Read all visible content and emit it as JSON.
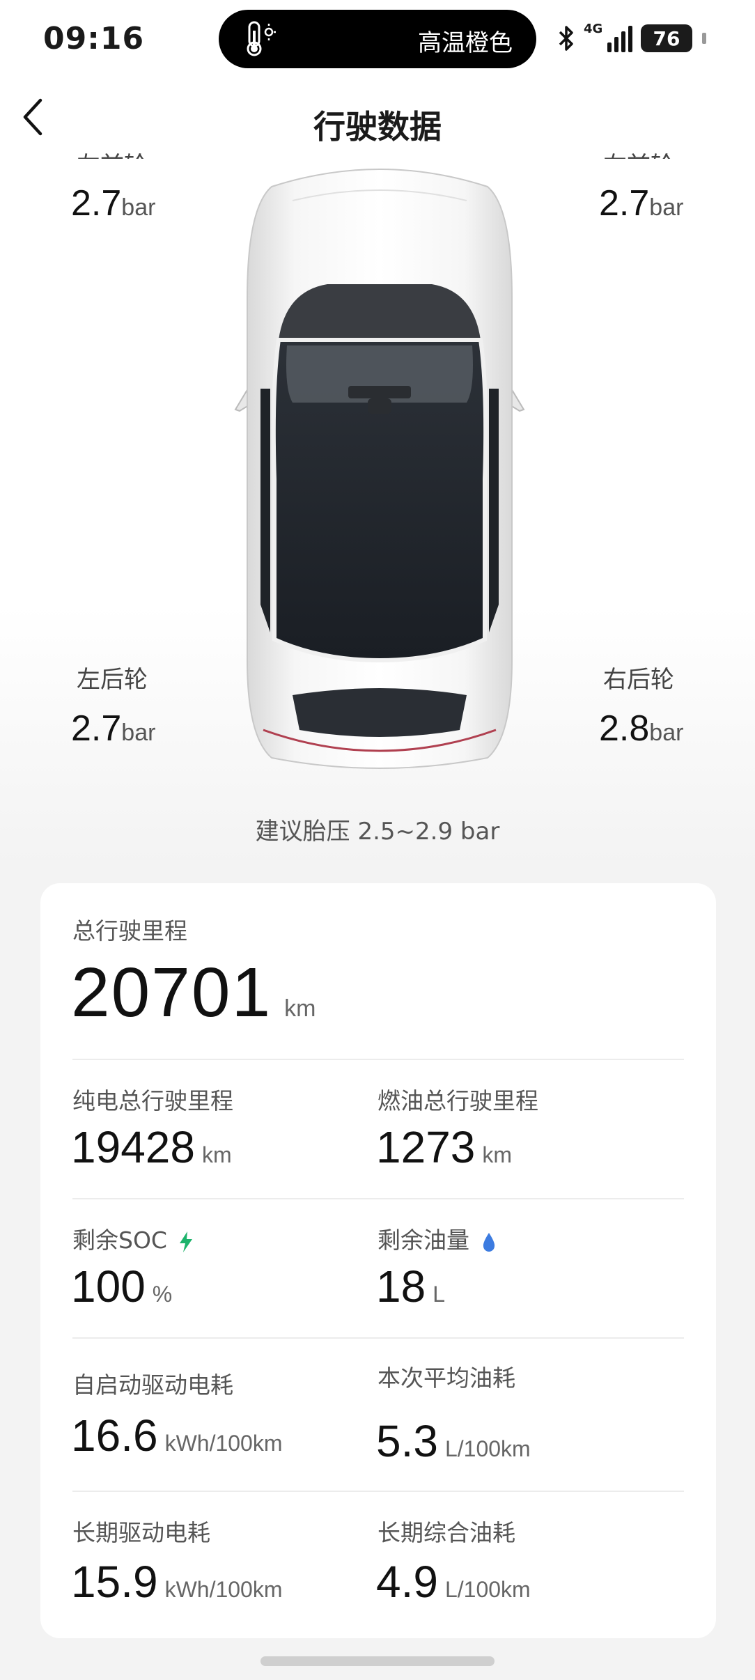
{
  "status_bar": {
    "time": "09:16",
    "island_text": "高温橙色",
    "network": "4G",
    "battery": "76"
  },
  "header": {
    "title": "行驶数据"
  },
  "tires": {
    "front_left": {
      "label": "左前轮",
      "value": "2.7",
      "unit": "bar"
    },
    "front_right": {
      "label": "右前轮",
      "value": "2.7",
      "unit": "bar"
    },
    "rear_left": {
      "label": "左后轮",
      "value": "2.7",
      "unit": "bar"
    },
    "rear_right": {
      "label": "右后轮",
      "value": "2.8",
      "unit": "bar"
    },
    "advice": "建议胎压 2.5~2.9 bar"
  },
  "stats": {
    "total": {
      "label": "总行驶里程",
      "value": "20701",
      "unit": "km"
    },
    "ev_total": {
      "label": "纯电总行驶里程",
      "value": "19428",
      "unit": "km"
    },
    "fuel_total": {
      "label": "燃油总行驶里程",
      "value": "1273",
      "unit": "km"
    },
    "soc": {
      "label": "剩余SOC",
      "value": "100",
      "unit": "%"
    },
    "fuel_left": {
      "label": "剩余油量",
      "value": "18",
      "unit": "L"
    },
    "trip_power": {
      "label": "自启动驱动电耗",
      "value": "16.6",
      "unit": "kWh/100km"
    },
    "trip_fuel": {
      "label": "本次平均油耗",
      "value": "5.3",
      "unit": "L/100km"
    },
    "long_power": {
      "label": "长期驱动电耗",
      "value": "15.9",
      "unit": "kWh/100km"
    },
    "long_fuel": {
      "label": "长期综合油耗",
      "value": "4.9",
      "unit": "L/100km"
    }
  },
  "colors": {
    "soc_icon": "#1db36b",
    "fuel_icon": "#3c7be0"
  }
}
